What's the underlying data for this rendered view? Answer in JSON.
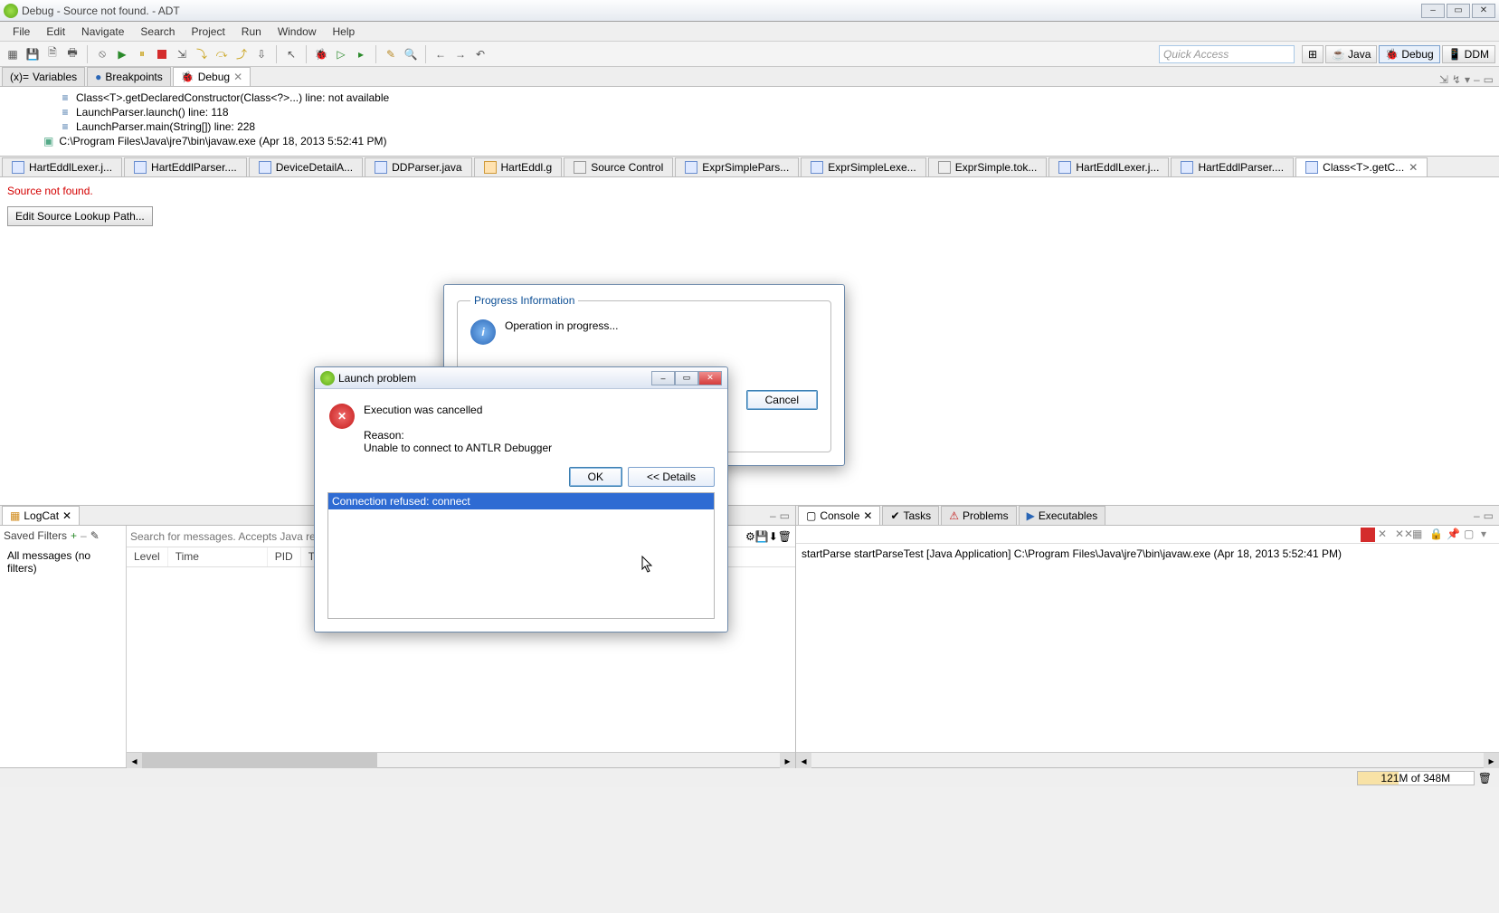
{
  "window": {
    "title": "Debug - Source not found. - ADT"
  },
  "menu": {
    "file": "File",
    "edit": "Edit",
    "navigate": "Navigate",
    "search": "Search",
    "project": "Project",
    "run": "Run",
    "window": "Window",
    "help": "Help"
  },
  "quickaccess_placeholder": "Quick Access",
  "perspectives": {
    "java": "Java",
    "debug": "Debug",
    "ddms": "DDM"
  },
  "views": {
    "variables": "Variables",
    "breakpoints": "Breakpoints",
    "debug": "Debug"
  },
  "stack": [
    "Class<T>.getDeclaredConstructor(Class<?>...) line: not available",
    "LaunchParser.launch() line: 118",
    "LaunchParser.main(String[]) line: 228",
    "C:\\Program Files\\Java\\jre7\\bin\\javaw.exe (Apr 18, 2013 5:52:41 PM)"
  ],
  "editor_tabs": [
    "HartEddlLexer.j...",
    "HartEddlParser....",
    "DeviceDetailA...",
    "DDParser.java",
    "HartEddl.g",
    "Source Control",
    "ExprSimplePars...",
    "ExprSimpleLexe...",
    "ExprSimple.tok...",
    "HartEddlLexer.j...",
    "HartEddlParser....",
    "Class<T>.getC..."
  ],
  "editor": {
    "error": "Source not found.",
    "lookup_btn": "Edit Source Lookup Path..."
  },
  "logcat": {
    "tab": "LogCat",
    "saved_filters": "Saved Filters",
    "all_messages": "All messages (no filters)",
    "search_ph": "Search for messages. Accepts Java regexes. P",
    "cols": {
      "level": "Level",
      "time": "Time",
      "pid": "PID",
      "tid": "T"
    }
  },
  "consolepane": {
    "tabs": {
      "console": "Console",
      "tasks": "Tasks",
      "problems": "Problems",
      "executables": "Executables"
    },
    "line": "startParse startParseTest [Java Application] C:\\Program Files\\Java\\jre7\\bin\\javaw.exe (Apr 18, 2013 5:52:41 PM)"
  },
  "status": {
    "mem": "121M of 348M"
  },
  "progress_dlg": {
    "legend": "Progress Information",
    "msg": "Operation in progress...",
    "cancel": "Cancel"
  },
  "launch_dlg": {
    "title": "Launch problem",
    "headline": "Execution was cancelled",
    "reason_label": "Reason:",
    "reason": "Unable to connect to ANTLR Debugger",
    "ok": "OK",
    "details": "<< Details",
    "detail_line": "Connection refused: connect"
  }
}
